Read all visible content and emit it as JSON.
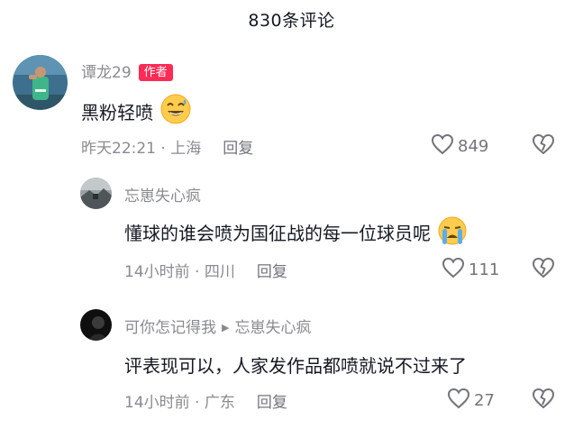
{
  "header": {
    "title": "830条评论"
  },
  "comments": [
    {
      "author": "谭龙29",
      "tag": "作者",
      "text": "黑粉轻喷",
      "emoji": "grin-sweat-emoji",
      "time": "昨天22:21",
      "location": "上海",
      "reply_label": "回复",
      "likes": "849"
    },
    {
      "author": "忘崽失心疯",
      "text": "懂球的谁会喷为国征战的每一位球员呢",
      "emoji": "loudly-crying-emoji",
      "time": "14小时前",
      "location": "四川",
      "reply_label": "回复",
      "likes": "111"
    },
    {
      "author": "可你怎记得我",
      "reply_to": "忘崽失心疯",
      "text": "评表现可以，人家发作品都喷就说不过来了",
      "time": "14小时前",
      "location": "广东",
      "reply_label": "回复",
      "likes": "27"
    }
  ],
  "separator": " · ",
  "colors": {
    "tag_bg": "#fe2c55",
    "muted": "#8a8b91",
    "text": "#161823"
  },
  "icons": [
    "heart-outline-icon",
    "broken-heart-icon",
    "reply-arrow-icon"
  ]
}
